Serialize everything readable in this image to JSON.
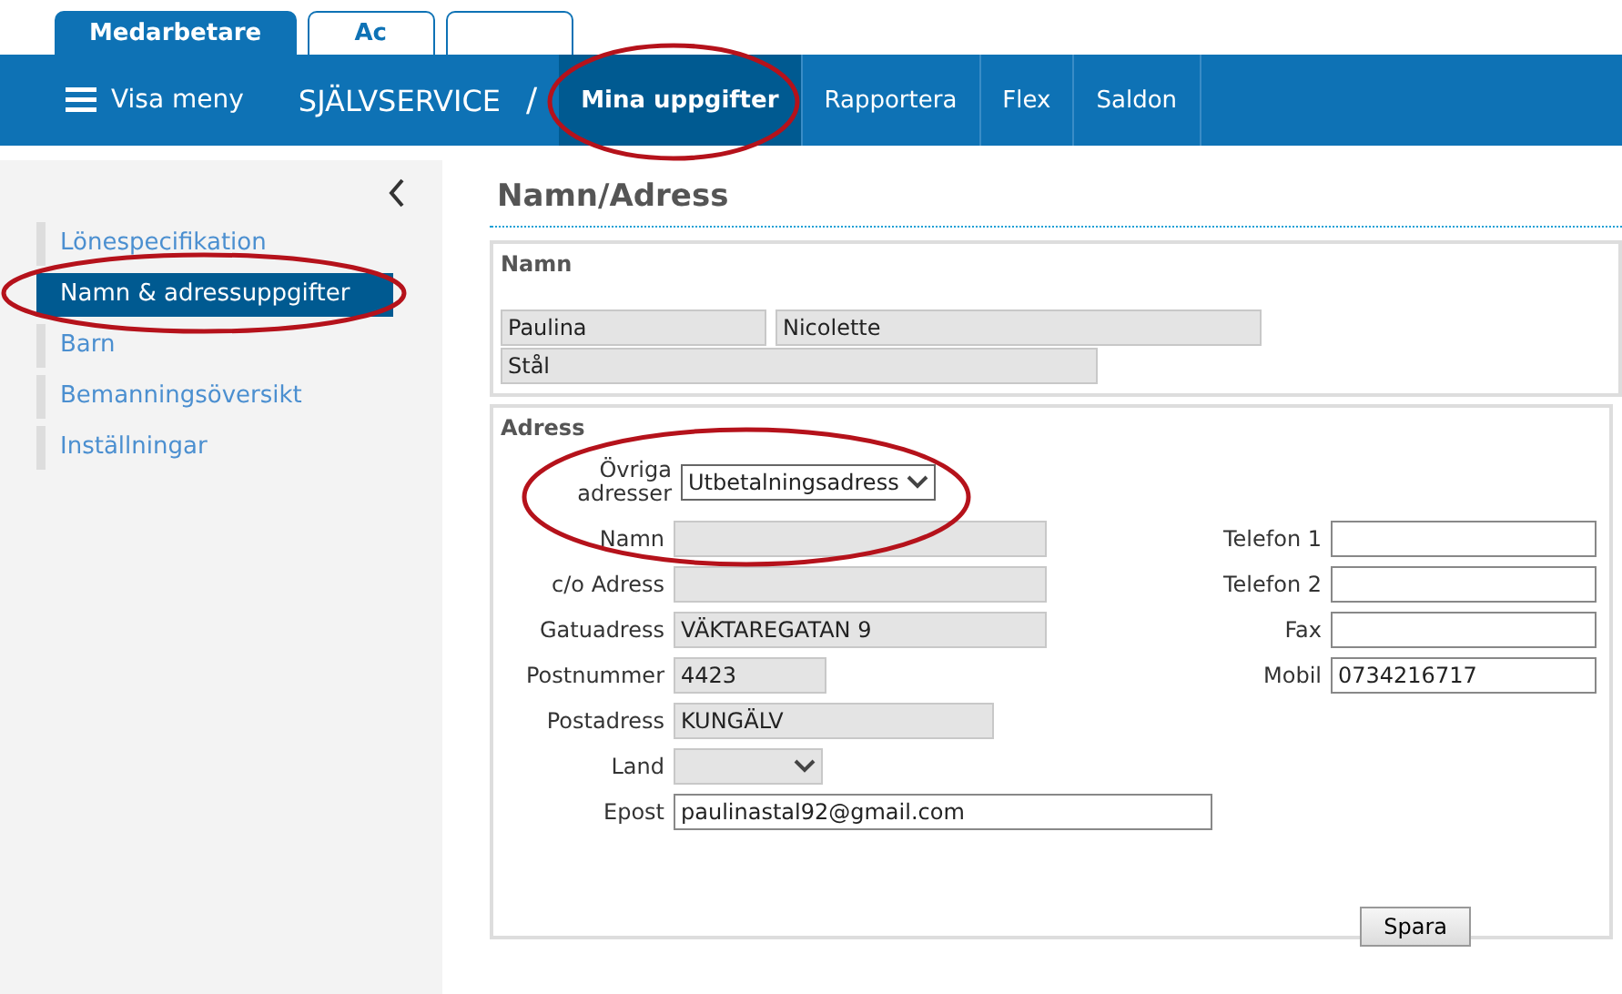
{
  "top_tabs": [
    {
      "label": "Medarbetare",
      "selected": true
    },
    {
      "label": "Ac",
      "selected": false
    },
    {
      "selected": false
    }
  ],
  "nav": {
    "menu_label": "Visa meny",
    "section": "SJÄLVSERVICE",
    "separator": "/",
    "items": [
      {
        "label": "Mina uppgifter",
        "selected": true
      },
      {
        "label": "Rapportera",
        "selected": false
      },
      {
        "label": "Flex",
        "selected": false
      },
      {
        "label": "Saldon",
        "selected": false
      }
    ]
  },
  "sidebar": {
    "items": [
      {
        "label": "Lönespecifikation",
        "selected": false
      },
      {
        "label": "Namn & adressuppgifter",
        "selected": true
      },
      {
        "label": "Barn",
        "selected": false
      },
      {
        "label": "Bemanningsöversikt",
        "selected": false
      },
      {
        "label": "Inställningar",
        "selected": false
      }
    ]
  },
  "page_title": "Namn/Adress",
  "name_section": {
    "title": "Namn",
    "first_name": "Paulina",
    "middle_name": "Nicolette",
    "last_name": "Stål"
  },
  "address_section": {
    "title": "Adress",
    "other_label": "Övriga adresser",
    "other_value": "Utbetalningsadress",
    "left_fields": [
      {
        "label": "Namn",
        "kind": "text",
        "readonly": true
      },
      {
        "label": "c/o Adress",
        "kind": "text",
        "readonly": true
      },
      {
        "label": "Gatuadress",
        "value": "VÄKTAREGATAN 9",
        "kind": "text",
        "readonly": true
      },
      {
        "label": "Postnummer",
        "value": "4423",
        "kind": "short",
        "readonly": true
      },
      {
        "label": "Postadress",
        "value": "KUNGÄLV",
        "kind": "medium",
        "readonly": true
      },
      {
        "label": "Land",
        "kind": "select",
        "readonly": true
      },
      {
        "label": "Epost",
        "value": "paulinastal92@gmail.com",
        "kind": "wide",
        "readonly": false
      }
    ],
    "right_fields": [
      {
        "label": "Telefon 1",
        "readonly": false
      },
      {
        "label": "Telefon 2",
        "readonly": false
      },
      {
        "label": "Fax",
        "readonly": false
      },
      {
        "label": "Mobil",
        "value": "0734216717",
        "readonly": false
      }
    ],
    "save_button": "Spara"
  }
}
